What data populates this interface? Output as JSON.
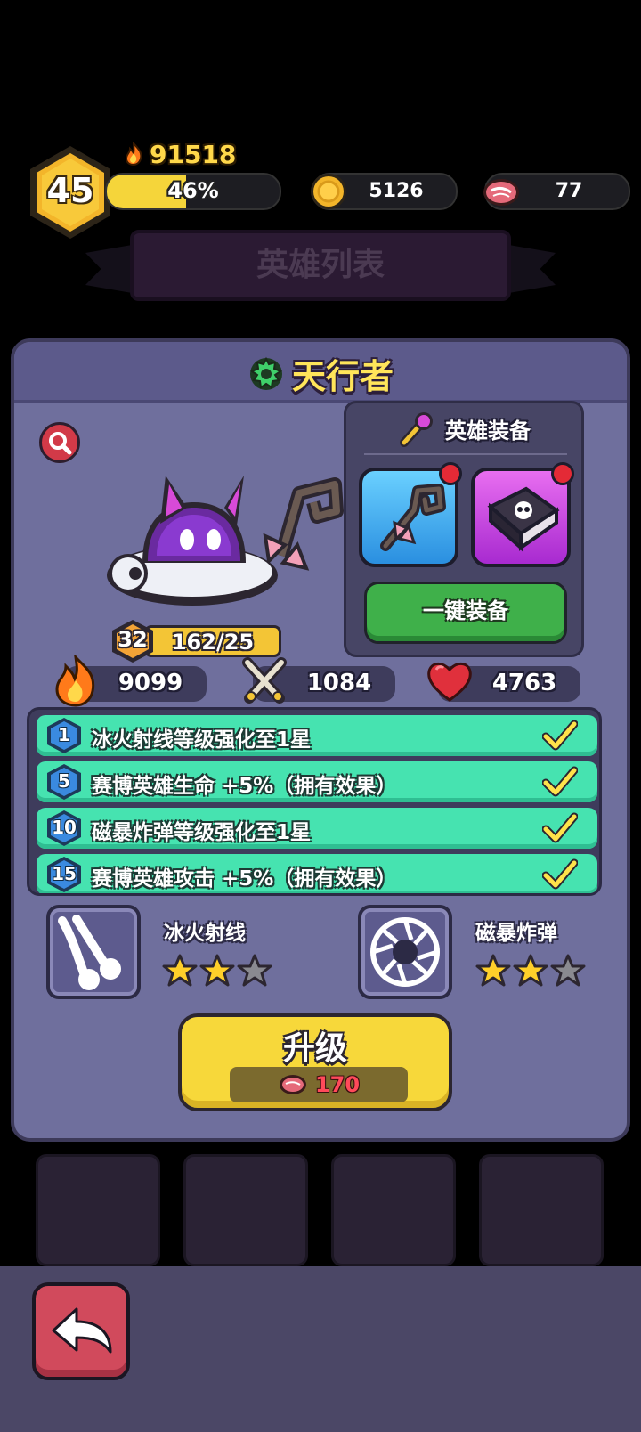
{
  "player": {
    "level": "45",
    "power": "91518",
    "xp_percent_label": "46%",
    "xp_fraction": 0.46
  },
  "resources": {
    "coins": "5126",
    "meat": "77"
  },
  "background": {
    "banner_title": "英雄列表"
  },
  "hero": {
    "name": "天行者",
    "level": "32",
    "shards": "162/25",
    "stats": {
      "power": "9099",
      "attack": "1084",
      "hp": "4763"
    }
  },
  "equipment": {
    "title": "英雄装备",
    "equip_all_label": "一键装备",
    "slots": [
      "staff-icon",
      "skull-book-icon"
    ]
  },
  "perks": [
    {
      "level": "1",
      "text": "冰火射线等级强化至1星",
      "done": true
    },
    {
      "level": "5",
      "text": "赛博英雄生命 +5%（拥有效果）",
      "done": true
    },
    {
      "level": "10",
      "text": "磁暴炸弹等级强化至1星",
      "done": true
    },
    {
      "level": "15",
      "text": "赛博英雄攻击 +5%（拥有效果）",
      "done": true
    }
  ],
  "skills": [
    {
      "name": "冰火射线",
      "stars": 2,
      "max_stars": 3
    },
    {
      "name": "磁暴炸弹",
      "stars": 2,
      "max_stars": 3
    }
  ],
  "upgrade": {
    "label": "升级",
    "cost": "170"
  },
  "colors": {
    "gold": "#f7d83a",
    "panel": "#6f6f9d",
    "perk_green": "#46e3b0",
    "equip_green": "#3fb04a",
    "back_red": "#d14a5c"
  }
}
